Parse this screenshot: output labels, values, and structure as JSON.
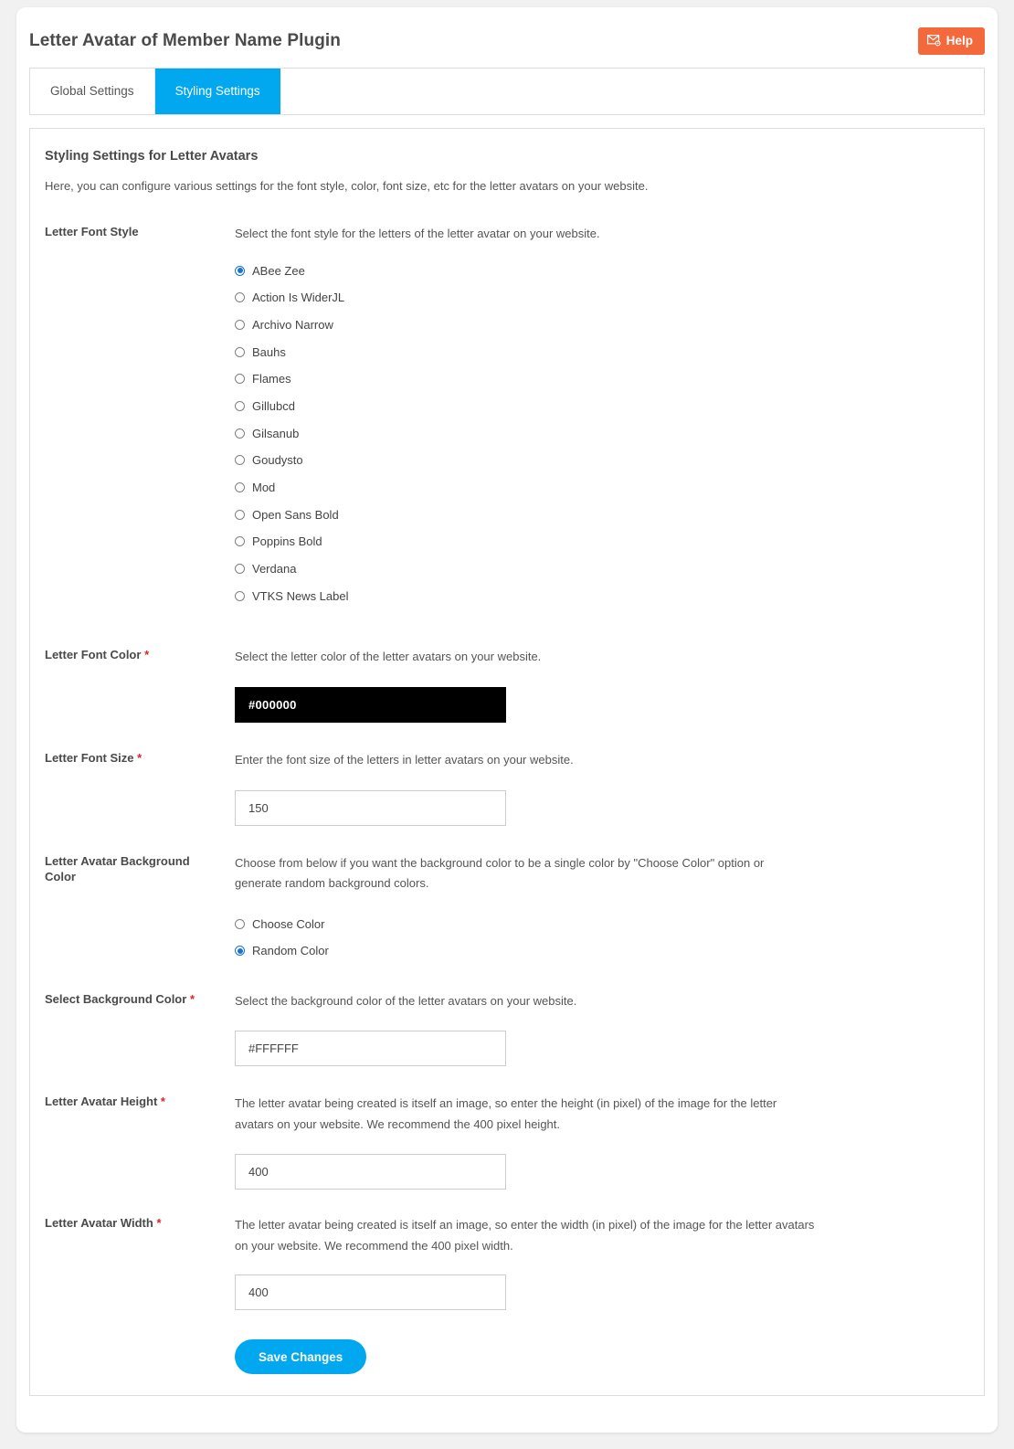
{
  "header": {
    "title": "Letter Avatar of Member Name Plugin",
    "help_label": "Help",
    "help_icon": "mail-gear-icon",
    "help_color": "#f4693b"
  },
  "tabs": [
    {
      "label": "Global Settings",
      "active": false
    },
    {
      "label": "Styling Settings",
      "active": true
    }
  ],
  "accent_color": "#02a8ef",
  "panel": {
    "title": "Styling Settings for Letter Avatars",
    "description": "Here, you can configure various settings for the font style, color, font size, etc for the letter avatars on your website."
  },
  "fields": {
    "font_style": {
      "label": "Letter Font Style",
      "required": false,
      "help": "Select the font style for the letters of the letter avatar on your website.",
      "options": [
        "ABee Zee",
        "Action Is WiderJL",
        "Archivo Narrow",
        "Bauhs",
        "Flames",
        "Gillubcd",
        "Gilsanub",
        "Goudysto",
        "Mod",
        "Open Sans Bold",
        "Poppins Bold",
        "Verdana",
        "VTKS News Label"
      ],
      "selected": "ABee Zee"
    },
    "font_color": {
      "label": "Letter Font Color",
      "required": true,
      "help": "Select the letter color of the letter avatars on your website.",
      "value": "#000000",
      "swatch": "#000000"
    },
    "font_size": {
      "label": "Letter Font Size",
      "required": true,
      "help": "Enter the font size of the letters in letter avatars on your website.",
      "value": "150"
    },
    "background_color_mode": {
      "label": "Letter Avatar Background Color",
      "required": false,
      "help": "Choose from below if you want the background color to be a single color by \"Choose Color\" option or generate random background colors.",
      "options": [
        "Choose Color",
        "Random Color"
      ],
      "selected": "Random Color"
    },
    "background_color": {
      "label": "Select Background Color",
      "required": true,
      "help": "Select the background color of the letter avatars on your website.",
      "value": "#FFFFFF"
    },
    "avatar_height": {
      "label": "Letter Avatar Height",
      "required": true,
      "help": "The letter avatar being created is itself an image, so enter the height (in pixel) of the image for the letter avatars on your website. We recommend the 400 pixel height.",
      "value": "400"
    },
    "avatar_width": {
      "label": "Letter Avatar Width",
      "required": true,
      "help": "The letter avatar being created is itself an image, so enter the width (in pixel) of the image for the letter avatars on your website. We recommend the 400 pixel width.",
      "value": "400"
    }
  },
  "actions": {
    "save_label": "Save Changes"
  }
}
